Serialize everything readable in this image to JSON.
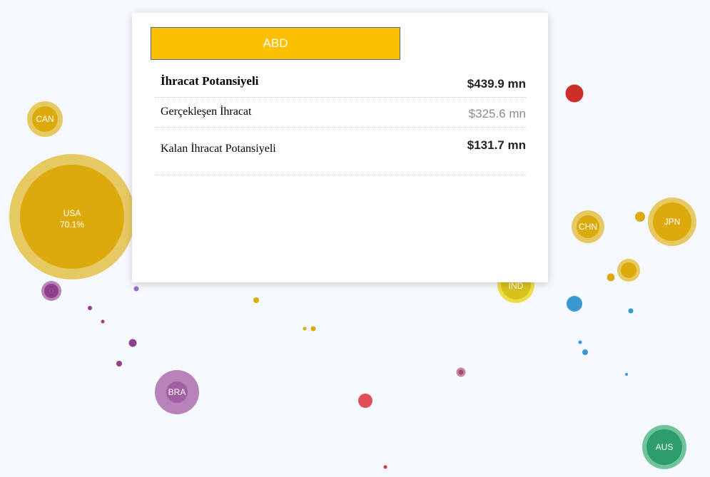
{
  "colors": {
    "background": "#f5f8fc",
    "gold": "#dcaa0c",
    "gold_halo": "#e6c962",
    "purple": "#8e3f8e",
    "purple_light": "#b783b8",
    "blue": "#3b97d1",
    "red": "#d8343c",
    "green": "#2e9c6c",
    "header_yellow": "#fcc000"
  },
  "bubbles": {
    "can": {
      "label": "CAN"
    },
    "usa": {
      "label": "USA",
      "share": "70.1%"
    },
    "chn": {
      "label": "CHN"
    },
    "jpn": {
      "label": "JPN"
    },
    "ind": {
      "label": "IND"
    },
    "bra": {
      "label": "BRA"
    },
    "aus": {
      "label": "AUS"
    }
  },
  "tooltip": {
    "title": "ABD",
    "rows": [
      {
        "label": "İhracat Potansiyeli",
        "value": "$439.9 mn"
      },
      {
        "label": "Gerçekleşen İhracat",
        "value": "$325.6 mn"
      },
      {
        "label": "Kalan İhracat Potansiyeli",
        "value": "$131.7 mn"
      }
    ]
  }
}
